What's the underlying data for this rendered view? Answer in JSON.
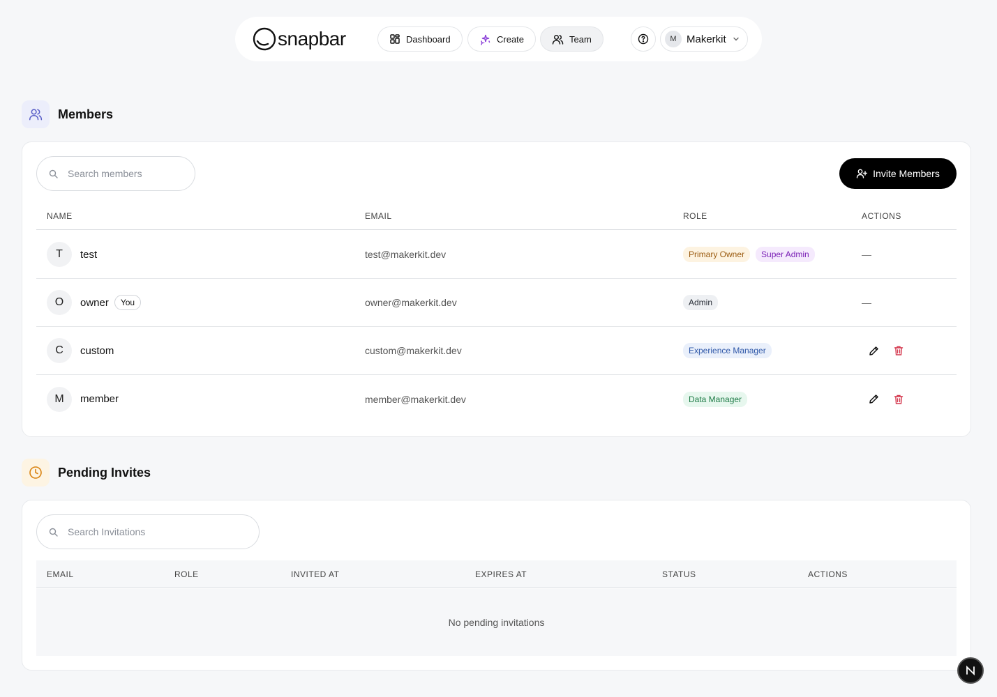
{
  "nav": {
    "logo_text": "snapbar",
    "dashboard_label": "Dashboard",
    "create_label": "Create",
    "team_label": "Team",
    "account_initial": "M",
    "account_name": "Makerkit",
    "active_tab": "Team"
  },
  "members": {
    "title": "Members",
    "search_placeholder": "Search members",
    "invite_label": "Invite Members",
    "columns": [
      "NAME",
      "EMAIL",
      "ROLE",
      "ACTIONS"
    ],
    "rows": [
      {
        "initial": "T",
        "name": "test",
        "email": "test@makerkit.dev",
        "you": "",
        "roles": [
          "Primary Owner",
          "Super Admin"
        ],
        "actions": "—"
      },
      {
        "initial": "O",
        "name": "owner",
        "email": "owner@makerkit.dev",
        "you": "You",
        "roles": [
          "Admin"
        ],
        "actions": "—"
      },
      {
        "initial": "C",
        "name": "custom",
        "email": "custom@makerkit.dev",
        "you": "",
        "roles": [
          "Experience Manager"
        ],
        "actions": "edit-delete"
      },
      {
        "initial": "M",
        "name": "member",
        "email": "member@makerkit.dev",
        "you": "",
        "roles": [
          "Data Manager"
        ],
        "actions": "edit-delete"
      }
    ]
  },
  "invites": {
    "title": "Pending Invites",
    "search_placeholder": "Search Invitations",
    "columns": [
      "EMAIL",
      "ROLE",
      "INVITED AT",
      "EXPIRES AT",
      "STATUS",
      "ACTIONS"
    ],
    "empty_text": "No pending invitations"
  },
  "colors": {
    "primary_owner_bg": "#fdf3e1",
    "primary_owner_fg": "#9a5b10",
    "super_admin_bg": "#f5eafd",
    "super_admin_fg": "#7a1fb5",
    "admin_bg": "#eef0f3",
    "admin_fg": "#2a2f38",
    "experience_manager_bg": "#eaf0fb",
    "experience_manager_fg": "#2e57a8",
    "data_manager_bg": "#e7f7ee",
    "data_manager_fg": "#1c7a45",
    "delete_icon": "#d4374d"
  },
  "icons": {
    "members_section": "users-icon",
    "invites_section": "clock-icon",
    "floating": "next-n-icon"
  }
}
